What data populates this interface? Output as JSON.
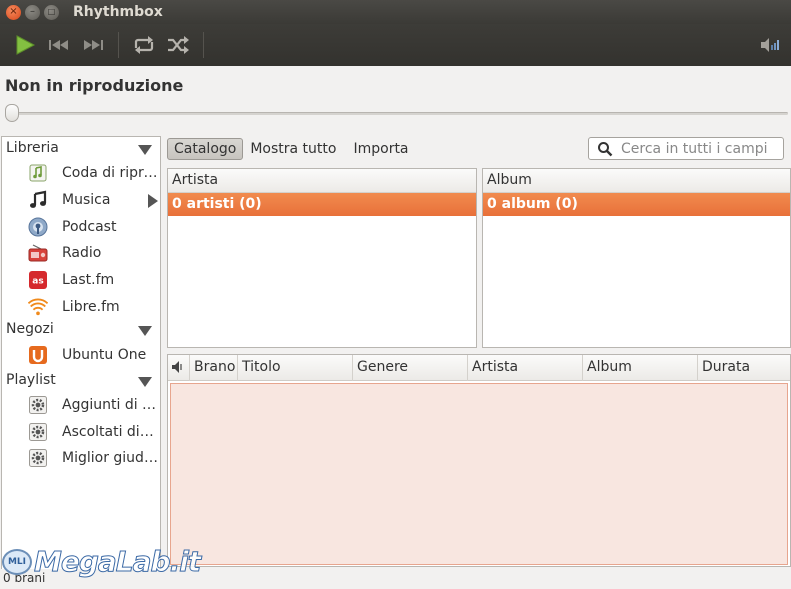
{
  "window": {
    "title": "Rhythmbox",
    "close_glyph": "×",
    "min_glyph": "–",
    "max_glyph": "□"
  },
  "toolbar": {
    "icons": [
      "play-icon",
      "previous-icon",
      "next-icon",
      "repeat-icon",
      "shuffle-icon",
      "volume-icon"
    ],
    "play_color": "#7fbf3f"
  },
  "now_playing": {
    "title": "Non in riproduzione",
    "progress": 0
  },
  "sidebar": {
    "sections": [
      {
        "label": "Libreria",
        "items": [
          {
            "label": "Coda di riproduzione",
            "icon": "queue-icon"
          },
          {
            "label": "Musica",
            "icon": "music-note-icon",
            "has_submenu": true
          },
          {
            "label": "Podcast",
            "icon": "podcast-icon"
          },
          {
            "label": "Radio",
            "icon": "radio-icon"
          },
          {
            "label": "Last.fm",
            "icon": "lastfm-icon"
          },
          {
            "label": "Libre.fm",
            "icon": "librefm-icon"
          }
        ]
      },
      {
        "label": "Negozi",
        "items": [
          {
            "label": "Ubuntu One",
            "icon": "ubuntu-one-icon"
          }
        ]
      },
      {
        "label": "Playlist",
        "items": [
          {
            "label": "Aggiunti di recente",
            "icon": "gear-icon"
          },
          {
            "label": "Ascoltati di recente",
            "icon": "gear-icon"
          },
          {
            "label": "Miglior giudizio",
            "icon": "gear-icon"
          }
        ]
      }
    ]
  },
  "browser": {
    "buttons": [
      "Catalogo",
      "Mostra tutto",
      "Importa"
    ],
    "search_placeholder": "Cerca in tutti i campi"
  },
  "panes": {
    "artist": {
      "header": "Artista",
      "row": "0 artisti (0)"
    },
    "album": {
      "header": "Album",
      "row": "0 album (0)"
    }
  },
  "tracks": {
    "columns": [
      "Brano",
      "Titolo",
      "Genere",
      "Artista",
      "Album",
      "Durata"
    ]
  },
  "status": {
    "text": "0 brani"
  },
  "watermark": {
    "text": "MegaLab.it",
    "badge": "MLI"
  },
  "colors": {
    "accent": "#e8703a",
    "titlebar": "#3c3b37",
    "selection_bg": "#f8e6e0"
  }
}
